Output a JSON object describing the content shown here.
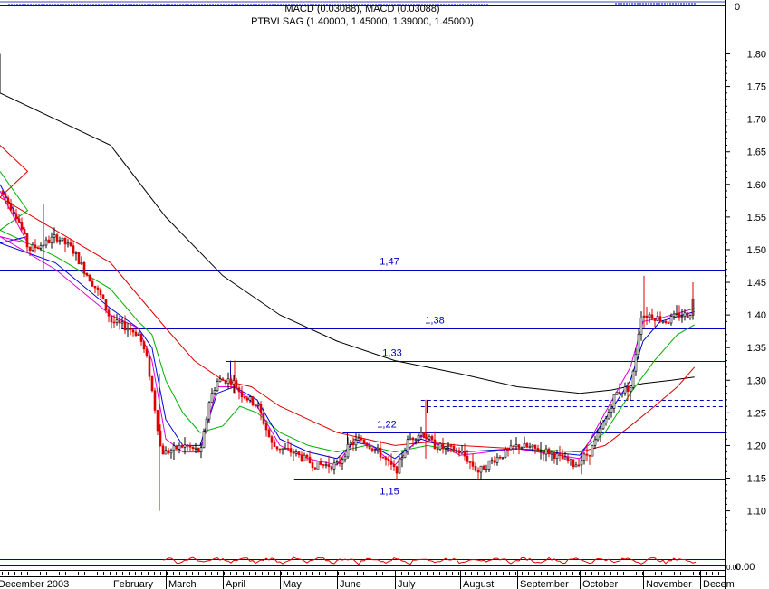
{
  "chart_data": {
    "type": "candlestick",
    "title": "PTBVLSAG (1.40000, 1.45000, 1.39000, 1.45000)",
    "macd_label": "MACD (0.03088), MACD (0.03088)",
    "macd_scale_label": "0",
    "bottom_scale_label": "0.00",
    "bottom_scale_label_inner": "0.00",
    "ylim": [
      1.08,
      1.93
    ],
    "yticks": [
      "1.80",
      "1.75",
      "1.70",
      "1.65",
      "1.60",
      "1.55",
      "1.50",
      "1.45",
      "1.40",
      "1.35",
      "1.30",
      "1.25",
      "1.20",
      "1.15",
      "1.10"
    ],
    "months": [
      {
        "label": "December 2003",
        "pos": 0
      },
      {
        "label": "February",
        "pos": 2.0
      },
      {
        "label": "March",
        "pos": 3.0
      },
      {
        "label": "April",
        "pos": 4.0
      },
      {
        "label": "May",
        "pos": 5.0
      },
      {
        "label": "June",
        "pos": 6.0
      },
      {
        "label": "July",
        "pos": 7.0
      },
      {
        "label": "August",
        "pos": 8.0
      },
      {
        "label": "September",
        "pos": 9.0
      },
      {
        "label": "October",
        "pos": 10.0
      },
      {
        "label": "November",
        "pos": 11.0
      },
      {
        "label": "Decem",
        "pos": 12.0
      }
    ],
    "levels": [
      {
        "value": 1.47,
        "label": "1,47",
        "from": 0,
        "to": 12.5,
        "style": "solid"
      },
      {
        "value": 1.38,
        "label": "1,38",
        "from": 2.2,
        "to": 12.5,
        "style": "solid"
      },
      {
        "value": 1.33,
        "label": "1,33",
        "from": 4.05,
        "to": 12.5,
        "style": "solid"
      },
      {
        "value": 1.22,
        "label": "1,22",
        "from": 6.1,
        "to": 12.5,
        "style": "solid"
      },
      {
        "value": 1.15,
        "label": "1,15",
        "from": 5.25,
        "to": 12.5,
        "style": "solid"
      },
      {
        "value": 1.27,
        "label": "",
        "from": 7.4,
        "to": 12.5,
        "style": "dashed"
      },
      {
        "value": 1.26,
        "label": "",
        "from": 7.4,
        "to": 12.5,
        "style": "dashed"
      }
    ],
    "price_anchors": [
      [
        0.0,
        1.59
      ],
      [
        0.3,
        1.55
      ],
      [
        0.5,
        1.5
      ],
      [
        0.8,
        1.51
      ],
      [
        1.0,
        1.52
      ],
      [
        1.3,
        1.5
      ],
      [
        1.5,
        1.47
      ],
      [
        1.8,
        1.43
      ],
      [
        2.0,
        1.39
      ],
      [
        2.3,
        1.38
      ],
      [
        2.5,
        1.37
      ],
      [
        2.65,
        1.33
      ],
      [
        2.8,
        1.25
      ],
      [
        2.9,
        1.19
      ],
      [
        3.0,
        1.19
      ],
      [
        3.3,
        1.2
      ],
      [
        3.6,
        1.19
      ],
      [
        3.75,
        1.27
      ],
      [
        3.9,
        1.3
      ],
      [
        4.0,
        1.3
      ],
      [
        4.15,
        1.3
      ],
      [
        4.3,
        1.28
      ],
      [
        4.6,
        1.26
      ],
      [
        4.85,
        1.2
      ],
      [
        5.2,
        1.19
      ],
      [
        5.6,
        1.17
      ],
      [
        6.0,
        1.17
      ],
      [
        6.2,
        1.2
      ],
      [
        6.4,
        1.21
      ],
      [
        6.7,
        1.19
      ],
      [
        7.0,
        1.16
      ],
      [
        7.2,
        1.21
      ],
      [
        7.4,
        1.22
      ],
      [
        7.6,
        1.2
      ],
      [
        8.0,
        1.19
      ],
      [
        8.3,
        1.16
      ],
      [
        8.6,
        1.18
      ],
      [
        9.0,
        1.2
      ],
      [
        9.5,
        1.19
      ],
      [
        9.9,
        1.17
      ],
      [
        10.15,
        1.19
      ],
      [
        10.4,
        1.24
      ],
      [
        10.55,
        1.28
      ],
      [
        10.8,
        1.29
      ],
      [
        10.95,
        1.4
      ],
      [
        11.1,
        1.4
      ],
      [
        11.4,
        1.39
      ],
      [
        11.6,
        1.4
      ],
      [
        11.8,
        1.4
      ],
      [
        11.9,
        1.44
      ]
    ],
    "ma_lines": [
      {
        "name": "",
        "color": "#000000",
        "values": [
          [
            0,
            1.8
          ],
          [
            1,
            1.74
          ],
          [
            2,
            1.66
          ],
          [
            3,
            1.55
          ],
          [
            4,
            1.46
          ],
          [
            5,
            1.4
          ],
          [
            6,
            1.36
          ],
          [
            7,
            1.33
          ],
          [
            8,
            1.31
          ],
          [
            9,
            1.29
          ],
          [
            10,
            1.28
          ],
          [
            10.5,
            1.285
          ],
          [
            11,
            1.295
          ],
          [
            11.5,
            1.3
          ],
          [
            11.9,
            1.305
          ]
        ]
      },
      {
        "name": "",
        "color": "#e00000",
        "values": [
          [
            0,
            1.66
          ],
          [
            0.5,
            1.62
          ],
          [
            1,
            1.58
          ],
          [
            1.5,
            1.53
          ],
          [
            2,
            1.48
          ],
          [
            2.5,
            1.43
          ],
          [
            3,
            1.38
          ],
          [
            3.5,
            1.33
          ],
          [
            4,
            1.3
          ],
          [
            4.5,
            1.29
          ],
          [
            5,
            1.26
          ],
          [
            5.5,
            1.24
          ],
          [
            6,
            1.22
          ],
          [
            6.5,
            1.21
          ],
          [
            7,
            1.2
          ],
          [
            7.5,
            1.205
          ],
          [
            8,
            1.2
          ],
          [
            9,
            1.195
          ],
          [
            10,
            1.19
          ],
          [
            10.4,
            1.2
          ],
          [
            10.8,
            1.23
          ],
          [
            11.2,
            1.26
          ],
          [
            11.6,
            1.29
          ],
          [
            11.9,
            1.32
          ]
        ]
      },
      {
        "name": "",
        "color": "#00b000",
        "values": [
          [
            0,
            1.62
          ],
          [
            0.5,
            1.56
          ],
          [
            1,
            1.53
          ],
          [
            1.5,
            1.49
          ],
          [
            2,
            1.44
          ],
          [
            2.5,
            1.39
          ],
          [
            2.75,
            1.37
          ],
          [
            3,
            1.3
          ],
          [
            3.3,
            1.25
          ],
          [
            3.6,
            1.22
          ],
          [
            4,
            1.23
          ],
          [
            4.3,
            1.26
          ],
          [
            4.6,
            1.25
          ],
          [
            5,
            1.22
          ],
          [
            5.5,
            1.2
          ],
          [
            6,
            1.19
          ],
          [
            6.5,
            1.2
          ],
          [
            7,
            1.19
          ],
          [
            7.5,
            1.2
          ],
          [
            8,
            1.19
          ],
          [
            9,
            1.195
          ],
          [
            10,
            1.19
          ],
          [
            10.4,
            1.22
          ],
          [
            10.8,
            1.28
          ],
          [
            11.2,
            1.33
          ],
          [
            11.6,
            1.37
          ],
          [
            11.9,
            1.385
          ]
        ]
      },
      {
        "name": "",
        "color": "#0000e0",
        "values": [
          [
            0,
            1.6
          ],
          [
            0.5,
            1.52
          ],
          [
            1,
            1.51
          ],
          [
            1.5,
            1.48
          ],
          [
            2,
            1.41
          ],
          [
            2.5,
            1.38
          ],
          [
            2.75,
            1.35
          ],
          [
            3,
            1.24
          ],
          [
            3.3,
            1.2
          ],
          [
            3.6,
            1.2
          ],
          [
            3.9,
            1.28
          ],
          [
            4.2,
            1.29
          ],
          [
            4.6,
            1.27
          ],
          [
            5,
            1.21
          ],
          [
            5.5,
            1.19
          ],
          [
            6,
            1.18
          ],
          [
            6.3,
            1.205
          ],
          [
            6.6,
            1.2
          ],
          [
            7,
            1.18
          ],
          [
            7.4,
            1.21
          ],
          [
            8,
            1.19
          ],
          [
            9,
            1.195
          ],
          [
            10,
            1.185
          ],
          [
            10.4,
            1.24
          ],
          [
            10.8,
            1.3
          ],
          [
            11.0,
            1.36
          ],
          [
            11.3,
            1.39
          ],
          [
            11.9,
            1.405
          ]
        ]
      },
      {
        "name": "",
        "color": "#e000e0",
        "values": [
          [
            0,
            1.59
          ],
          [
            0.5,
            1.51
          ],
          [
            1,
            1.52
          ],
          [
            1.5,
            1.47
          ],
          [
            2,
            1.4
          ],
          [
            2.5,
            1.38
          ],
          [
            2.75,
            1.33
          ],
          [
            3,
            1.21
          ],
          [
            3.3,
            1.19
          ],
          [
            3.6,
            1.19
          ],
          [
            3.9,
            1.29
          ],
          [
            4.2,
            1.29
          ],
          [
            4.6,
            1.26
          ],
          [
            5,
            1.2
          ],
          [
            5.5,
            1.18
          ],
          [
            6,
            1.17
          ],
          [
            6.3,
            1.21
          ],
          [
            6.6,
            1.2
          ],
          [
            7,
            1.17
          ],
          [
            7.4,
            1.215
          ],
          [
            8,
            1.185
          ],
          [
            9,
            1.195
          ],
          [
            10,
            1.18
          ],
          [
            10.4,
            1.25
          ],
          [
            10.8,
            1.32
          ],
          [
            11.0,
            1.39
          ],
          [
            11.3,
            1.395
          ],
          [
            11.9,
            1.41
          ]
        ]
      }
    ]
  }
}
